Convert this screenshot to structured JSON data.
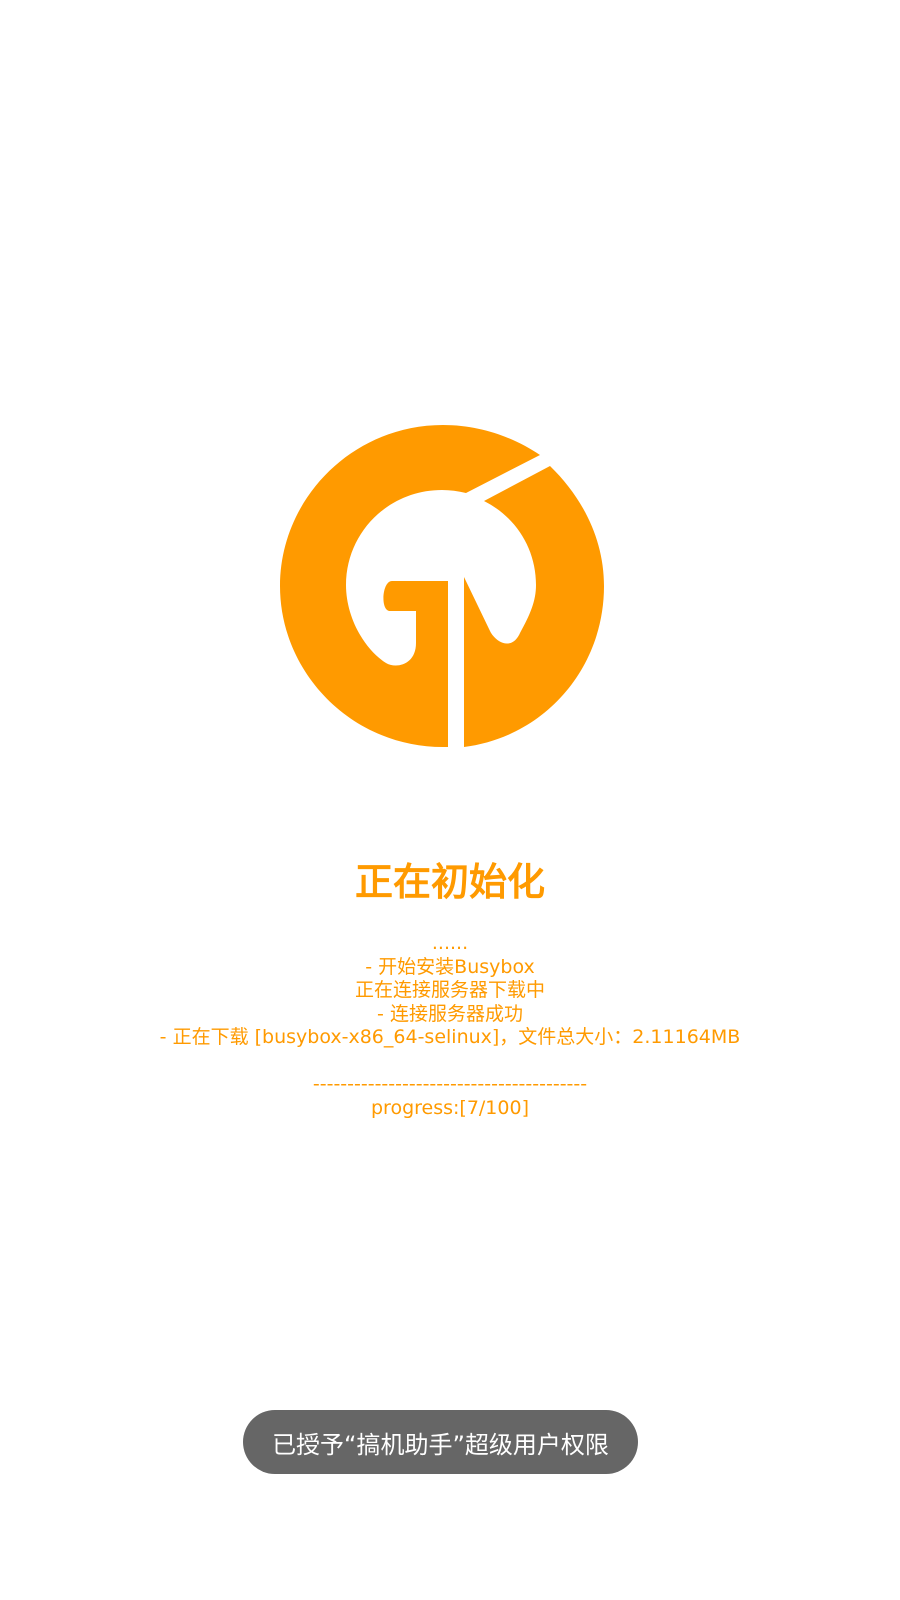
{
  "app": {
    "title": "正在初始化",
    "accent_color": "#ff9a00",
    "logo_icon": "app-logo-icon"
  },
  "log": {
    "lines": [
      "......",
      "- 开始安装Busybox",
      "正在连接服务器下载中",
      "- 连接服务器成功",
      "- 正在下载 [busybox-x86_64-selinux]，文件总大小：2.11164MB",
      "",
      "----------------------------------------",
      "progress:[7/100]"
    ],
    "progress_fraction": 0.07
  },
  "toast": {
    "text": "已授予“搞机助手”超级用户权限",
    "background": "#666666"
  }
}
